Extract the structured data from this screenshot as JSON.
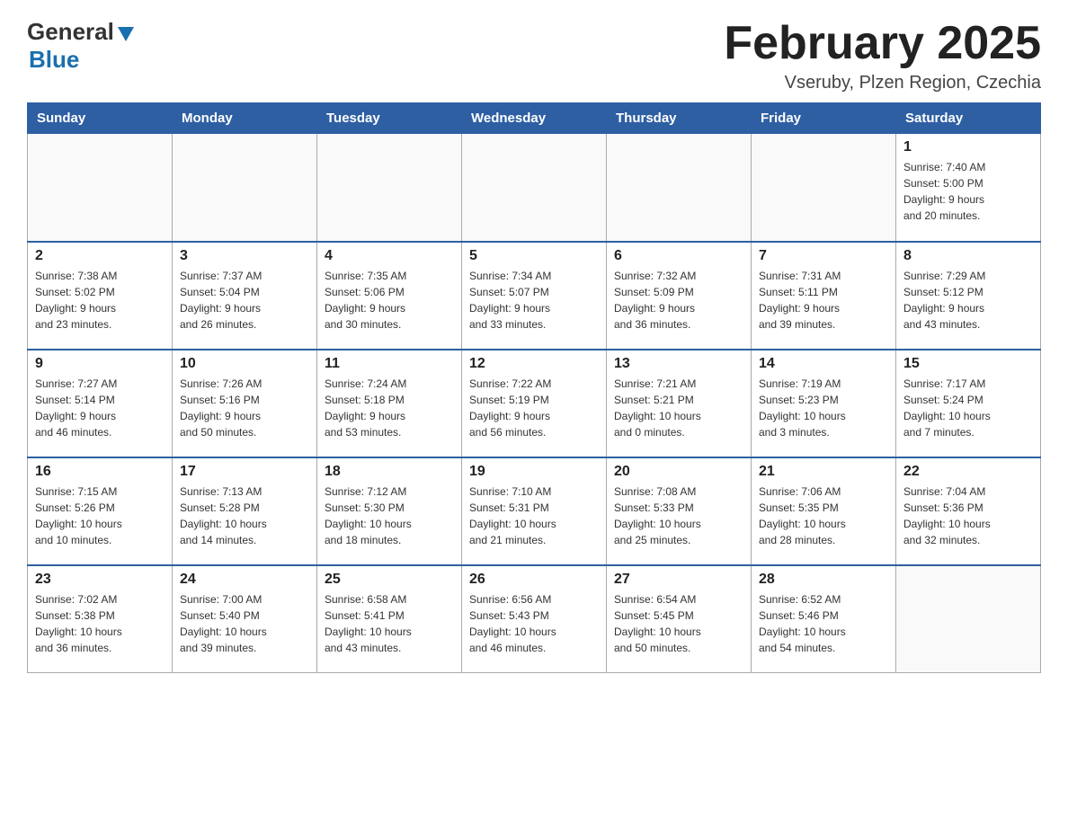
{
  "logo": {
    "general": "General",
    "blue": "Blue",
    "triangle": "▶"
  },
  "header": {
    "title": "February 2025",
    "location": "Vseruby, Plzen Region, Czechia"
  },
  "weekdays": [
    "Sunday",
    "Monday",
    "Tuesday",
    "Wednesday",
    "Thursday",
    "Friday",
    "Saturday"
  ],
  "weeks": [
    [
      {
        "day": "",
        "info": ""
      },
      {
        "day": "",
        "info": ""
      },
      {
        "day": "",
        "info": ""
      },
      {
        "day": "",
        "info": ""
      },
      {
        "day": "",
        "info": ""
      },
      {
        "day": "",
        "info": ""
      },
      {
        "day": "1",
        "info": "Sunrise: 7:40 AM\nSunset: 5:00 PM\nDaylight: 9 hours\nand 20 minutes."
      }
    ],
    [
      {
        "day": "2",
        "info": "Sunrise: 7:38 AM\nSunset: 5:02 PM\nDaylight: 9 hours\nand 23 minutes."
      },
      {
        "day": "3",
        "info": "Sunrise: 7:37 AM\nSunset: 5:04 PM\nDaylight: 9 hours\nand 26 minutes."
      },
      {
        "day": "4",
        "info": "Sunrise: 7:35 AM\nSunset: 5:06 PM\nDaylight: 9 hours\nand 30 minutes."
      },
      {
        "day": "5",
        "info": "Sunrise: 7:34 AM\nSunset: 5:07 PM\nDaylight: 9 hours\nand 33 minutes."
      },
      {
        "day": "6",
        "info": "Sunrise: 7:32 AM\nSunset: 5:09 PM\nDaylight: 9 hours\nand 36 minutes."
      },
      {
        "day": "7",
        "info": "Sunrise: 7:31 AM\nSunset: 5:11 PM\nDaylight: 9 hours\nand 39 minutes."
      },
      {
        "day": "8",
        "info": "Sunrise: 7:29 AM\nSunset: 5:12 PM\nDaylight: 9 hours\nand 43 minutes."
      }
    ],
    [
      {
        "day": "9",
        "info": "Sunrise: 7:27 AM\nSunset: 5:14 PM\nDaylight: 9 hours\nand 46 minutes."
      },
      {
        "day": "10",
        "info": "Sunrise: 7:26 AM\nSunset: 5:16 PM\nDaylight: 9 hours\nand 50 minutes."
      },
      {
        "day": "11",
        "info": "Sunrise: 7:24 AM\nSunset: 5:18 PM\nDaylight: 9 hours\nand 53 minutes."
      },
      {
        "day": "12",
        "info": "Sunrise: 7:22 AM\nSunset: 5:19 PM\nDaylight: 9 hours\nand 56 minutes."
      },
      {
        "day": "13",
        "info": "Sunrise: 7:21 AM\nSunset: 5:21 PM\nDaylight: 10 hours\nand 0 minutes."
      },
      {
        "day": "14",
        "info": "Sunrise: 7:19 AM\nSunset: 5:23 PM\nDaylight: 10 hours\nand 3 minutes."
      },
      {
        "day": "15",
        "info": "Sunrise: 7:17 AM\nSunset: 5:24 PM\nDaylight: 10 hours\nand 7 minutes."
      }
    ],
    [
      {
        "day": "16",
        "info": "Sunrise: 7:15 AM\nSunset: 5:26 PM\nDaylight: 10 hours\nand 10 minutes."
      },
      {
        "day": "17",
        "info": "Sunrise: 7:13 AM\nSunset: 5:28 PM\nDaylight: 10 hours\nand 14 minutes."
      },
      {
        "day": "18",
        "info": "Sunrise: 7:12 AM\nSunset: 5:30 PM\nDaylight: 10 hours\nand 18 minutes."
      },
      {
        "day": "19",
        "info": "Sunrise: 7:10 AM\nSunset: 5:31 PM\nDaylight: 10 hours\nand 21 minutes."
      },
      {
        "day": "20",
        "info": "Sunrise: 7:08 AM\nSunset: 5:33 PM\nDaylight: 10 hours\nand 25 minutes."
      },
      {
        "day": "21",
        "info": "Sunrise: 7:06 AM\nSunset: 5:35 PM\nDaylight: 10 hours\nand 28 minutes."
      },
      {
        "day": "22",
        "info": "Sunrise: 7:04 AM\nSunset: 5:36 PM\nDaylight: 10 hours\nand 32 minutes."
      }
    ],
    [
      {
        "day": "23",
        "info": "Sunrise: 7:02 AM\nSunset: 5:38 PM\nDaylight: 10 hours\nand 36 minutes."
      },
      {
        "day": "24",
        "info": "Sunrise: 7:00 AM\nSunset: 5:40 PM\nDaylight: 10 hours\nand 39 minutes."
      },
      {
        "day": "25",
        "info": "Sunrise: 6:58 AM\nSunset: 5:41 PM\nDaylight: 10 hours\nand 43 minutes."
      },
      {
        "day": "26",
        "info": "Sunrise: 6:56 AM\nSunset: 5:43 PM\nDaylight: 10 hours\nand 46 minutes."
      },
      {
        "day": "27",
        "info": "Sunrise: 6:54 AM\nSunset: 5:45 PM\nDaylight: 10 hours\nand 50 minutes."
      },
      {
        "day": "28",
        "info": "Sunrise: 6:52 AM\nSunset: 5:46 PM\nDaylight: 10 hours\nand 54 minutes."
      },
      {
        "day": "",
        "info": ""
      }
    ]
  ]
}
